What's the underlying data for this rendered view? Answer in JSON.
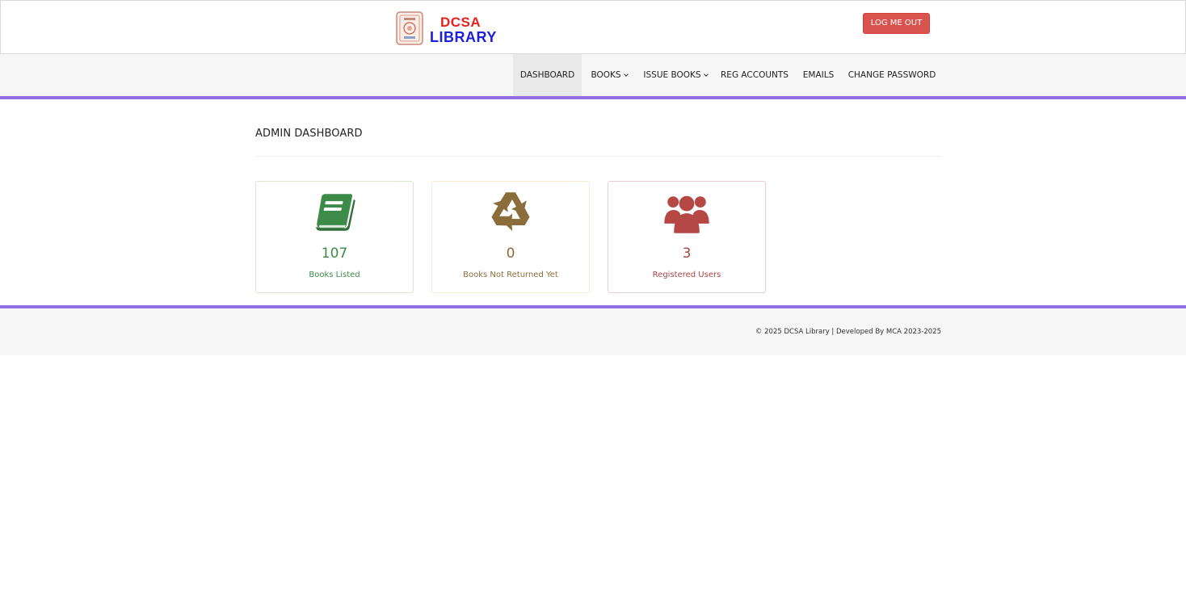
{
  "header": {
    "logo_line1": "DCSA",
    "logo_line2": "LIBRARY",
    "logout_label": "LOG ME OUT"
  },
  "nav": {
    "items": [
      {
        "label": "DASHBOARD",
        "dropdown": false,
        "active": true
      },
      {
        "label": "BOOKS",
        "dropdown": true,
        "active": false
      },
      {
        "label": "ISSUE BOOKS",
        "dropdown": true,
        "active": false
      },
      {
        "label": "REG ACCOUNTS",
        "dropdown": false,
        "active": false
      },
      {
        "label": "EMAILS",
        "dropdown": false,
        "active": false
      },
      {
        "label": "CHANGE PASSWORD",
        "dropdown": false,
        "active": false
      }
    ]
  },
  "main": {
    "title": "ADMIN DASHBOARD",
    "cards": [
      {
        "value": "107",
        "label": "Books Listed",
        "icon": "book-icon",
        "color": "#3d8b48",
        "border": "#d6e9c6"
      },
      {
        "value": "0",
        "label": "Books Not Returned Yet",
        "icon": "recycle-icon",
        "color": "#8a6d3b",
        "border": "#faebcc"
      },
      {
        "value": "3",
        "label": "Registered Users",
        "icon": "users-icon",
        "color": "#a94442",
        "border": "#ebccd1"
      }
    ]
  },
  "footer": {
    "text": "© 2025 DCSA Library | Developed By MCA 2023-2025"
  },
  "colors": {
    "accent": "#9170e6",
    "logout": "#d9534f"
  }
}
